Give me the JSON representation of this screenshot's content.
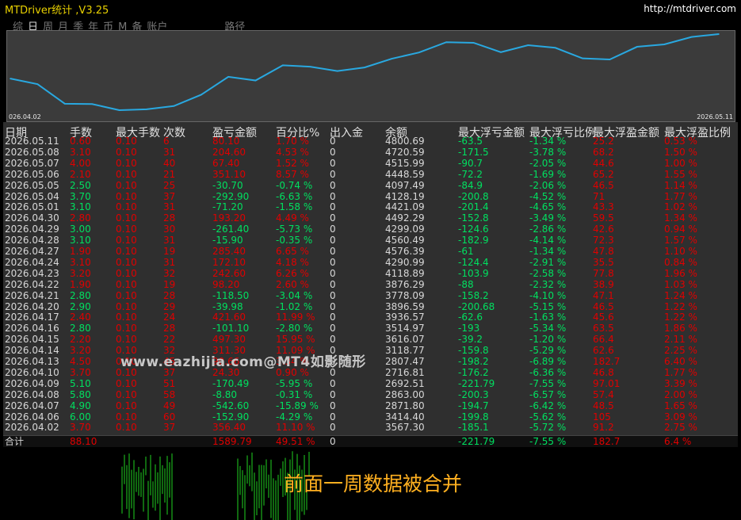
{
  "app": {
    "title": "MTDriver统计 ,V3.25",
    "url": "http://mtdriver.com"
  },
  "tabs": [
    {
      "label": "综",
      "active": false
    },
    {
      "label": "日",
      "active": true
    },
    {
      "label": "周",
      "active": false
    },
    {
      "label": "月",
      "active": false
    },
    {
      "label": "季",
      "active": false
    },
    {
      "label": "年",
      "active": false
    },
    {
      "label": "币",
      "active": false
    },
    {
      "label": "M",
      "active": false
    },
    {
      "label": "备",
      "active": false
    },
    {
      "label": "账户",
      "active": false
    }
  ],
  "path_label": "路径",
  "chart_data": {
    "type": "line",
    "x_start_label": "026.04.02",
    "x_end_label": "2026.05.11",
    "color": "#29a8e0",
    "x": [
      "2026.04.02",
      "2026.04.06",
      "2026.04.07",
      "2026.04.08",
      "2026.04.09",
      "2026.04.10",
      "2026.04.13",
      "2026.04.14",
      "2026.04.15",
      "2026.04.16",
      "2026.04.17",
      "2026.04.20",
      "2026.04.21",
      "2026.04.22",
      "2026.04.23",
      "2026.04.24",
      "2026.04.27",
      "2026.04.28",
      "2026.04.29",
      "2026.04.30",
      "2026.05.01",
      "2026.05.04",
      "2026.05.05",
      "2026.05.06",
      "2026.05.07",
      "2026.05.08",
      "2026.05.11"
    ],
    "values": [
      3567.3,
      3414.4,
      2871.8,
      2863.0,
      2692.51,
      2716.81,
      2807.47,
      3118.77,
      3616.07,
      3514.97,
      3936.57,
      3896.59,
      3778.09,
      3876.29,
      4118.89,
      4290.99,
      4576.39,
      4560.49,
      4299.09,
      4492.29,
      4421.09,
      4128.19,
      4097.49,
      4448.59,
      4515.99,
      4720.59,
      4800.69
    ]
  },
  "table": {
    "headers": [
      "日期",
      "手数",
      "最大手数",
      "次数",
      "盈亏金额",
      "百分比%",
      "出入金",
      "余额",
      "最大浮亏金额",
      "最大浮亏比例",
      "最大浮盈金额",
      "最大浮盈比例"
    ],
    "rows": [
      {
        "date": "2026.05.11",
        "lots": "0.60",
        "max_lots": "0.10",
        "count": "6",
        "pnl": "80.10",
        "pct": "1.70 %",
        "io": "0",
        "bal": "4800.69",
        "mfl": "-63.5",
        "mflp": "-1.34 %",
        "mfp": "25.2",
        "mfpp": "0.53 %",
        "s": "red"
      },
      {
        "date": "2026.05.08",
        "lots": "3.10",
        "max_lots": "0.10",
        "count": "31",
        "pnl": "204.60",
        "pct": "4.53 %",
        "io": "0",
        "bal": "4720.59",
        "mfl": "-171.5",
        "mflp": "-3.78 %",
        "mfp": "68.2",
        "mfpp": "1.50 %",
        "s": "red"
      },
      {
        "date": "2026.05.07",
        "lots": "4.00",
        "max_lots": "0.10",
        "count": "40",
        "pnl": "67.40",
        "pct": "1.52 %",
        "io": "0",
        "bal": "4515.99",
        "mfl": "-90.7",
        "mflp": "-2.05 %",
        "mfp": "44.6",
        "mfpp": "1.00 %",
        "s": "red"
      },
      {
        "date": "2026.05.06",
        "lots": "2.10",
        "max_lots": "0.10",
        "count": "21",
        "pnl": "351.10",
        "pct": "8.57 %",
        "io": "0",
        "bal": "4448.59",
        "mfl": "-72.2",
        "mflp": "-1.69 %",
        "mfp": "65.2",
        "mfpp": "1.55 %",
        "s": "red"
      },
      {
        "date": "2026.05.05",
        "lots": "2.50",
        "max_lots": "0.10",
        "count": "25",
        "pnl": "-30.70",
        "pct": "-0.74 %",
        "io": "0",
        "bal": "4097.49",
        "mfl": "-84.9",
        "mflp": "-2.06 %",
        "mfp": "46.5",
        "mfpp": "1.14 %",
        "s": "grn"
      },
      {
        "date": "2026.05.04",
        "lots": "3.70",
        "max_lots": "0.10",
        "count": "37",
        "pnl": "-292.90",
        "pct": "-6.63 %",
        "io": "0",
        "bal": "4128.19",
        "mfl": "-200.8",
        "mflp": "-4.52 %",
        "mfp": "71",
        "mfpp": "1.77 %",
        "s": "grn"
      },
      {
        "date": "2026.05.01",
        "lots": "3.10",
        "max_lots": "0.10",
        "count": "31",
        "pnl": "-71.20",
        "pct": "-1.58 %",
        "io": "0",
        "bal": "4421.09",
        "mfl": "-201.4",
        "mflp": "-4.65 %",
        "mfp": "43.3",
        "mfpp": "1.02 %",
        "s": "grn"
      },
      {
        "date": "2026.04.30",
        "lots": "2.80",
        "max_lots": "0.10",
        "count": "28",
        "pnl": "193.20",
        "pct": "4.49 %",
        "io": "0",
        "bal": "4492.29",
        "mfl": "-152.8",
        "mflp": "-3.49 %",
        "mfp": "59.5",
        "mfpp": "1.34 %",
        "s": "red"
      },
      {
        "date": "2026.04.29",
        "lots": "3.00",
        "max_lots": "0.10",
        "count": "30",
        "pnl": "-261.40",
        "pct": "-5.73 %",
        "io": "0",
        "bal": "4299.09",
        "mfl": "-124.6",
        "mflp": "-2.86 %",
        "mfp": "42.6",
        "mfpp": "0.94 %",
        "s": "grn"
      },
      {
        "date": "2026.04.28",
        "lots": "3.10",
        "max_lots": "0.10",
        "count": "31",
        "pnl": "-15.90",
        "pct": "-0.35 %",
        "io": "0",
        "bal": "4560.49",
        "mfl": "-182.9",
        "mflp": "-4.14 %",
        "mfp": "72.3",
        "mfpp": "1.57 %",
        "s": "grn"
      },
      {
        "date": "2026.04.27",
        "lots": "1.90",
        "max_lots": "0.10",
        "count": "19",
        "pnl": "285.40",
        "pct": "6.65 %",
        "io": "0",
        "bal": "4576.39",
        "mfl": "-61",
        "mflp": "-1.34 %",
        "mfp": "47.8",
        "mfpp": "1.10 %",
        "s": "red"
      },
      {
        "date": "2026.04.24",
        "lots": "3.10",
        "max_lots": "0.10",
        "count": "31",
        "pnl": "172.10",
        "pct": "4.18 %",
        "io": "0",
        "bal": "4290.99",
        "mfl": "-124.4",
        "mflp": "-2.91 %",
        "mfp": "35.5",
        "mfpp": "0.84 %",
        "s": "red"
      },
      {
        "date": "2026.04.23",
        "lots": "3.20",
        "max_lots": "0.10",
        "count": "32",
        "pnl": "242.60",
        "pct": "6.26 %",
        "io": "0",
        "bal": "4118.89",
        "mfl": "-103.9",
        "mflp": "-2.58 %",
        "mfp": "77.8",
        "mfpp": "1.96 %",
        "s": "red"
      },
      {
        "date": "2026.04.22",
        "lots": "1.90",
        "max_lots": "0.10",
        "count": "19",
        "pnl": "98.20",
        "pct": "2.60 %",
        "io": "0",
        "bal": "3876.29",
        "mfl": "-88",
        "mflp": "-2.32 %",
        "mfp": "38.9",
        "mfpp": "1.03 %",
        "s": "red"
      },
      {
        "date": "2026.04.21",
        "lots": "2.80",
        "max_lots": "0.10",
        "count": "28",
        "pnl": "-118.50",
        "pct": "-3.04 %",
        "io": "0",
        "bal": "3778.09",
        "mfl": "-158.2",
        "mflp": "-4.10 %",
        "mfp": "47.1",
        "mfpp": "1.24 %",
        "s": "grn"
      },
      {
        "date": "2026.04.20",
        "lots": "2.90",
        "max_lots": "0.10",
        "count": "29",
        "pnl": "-39.98",
        "pct": "-1.02 %",
        "io": "0",
        "bal": "3896.59",
        "mfl": "-200.68",
        "mflp": "-5.15 %",
        "mfp": "46.5",
        "mfpp": "1.22 %",
        "s": "grn"
      },
      {
        "date": "2026.04.17",
        "lots": "2.40",
        "max_lots": "0.10",
        "count": "24",
        "pnl": "421.60",
        "pct": "11.99 %",
        "io": "0",
        "bal": "3936.57",
        "mfl": "-62.6",
        "mflp": "-1.63 %",
        "mfp": "45.6",
        "mfpp": "1.22 %",
        "s": "red"
      },
      {
        "date": "2026.04.16",
        "lots": "2.80",
        "max_lots": "0.10",
        "count": "28",
        "pnl": "-101.10",
        "pct": "-2.80 %",
        "io": "0",
        "bal": "3514.97",
        "mfl": "-193",
        "mflp": "-5.34 %",
        "mfp": "63.5",
        "mfpp": "1.86 %",
        "s": "grn"
      },
      {
        "date": "2026.04.15",
        "lots": "2.20",
        "max_lots": "0.10",
        "count": "22",
        "pnl": "497.30",
        "pct": "15.95 %",
        "io": "0",
        "bal": "3616.07",
        "mfl": "-39.2",
        "mflp": "-1.20 %",
        "mfp": "66.4",
        "mfpp": "2.11 %",
        "s": "red"
      },
      {
        "date": "2026.04.14",
        "lots": "3.20",
        "max_lots": "0.10",
        "count": "32",
        "pnl": "311.30",
        "pct": "11.09 %",
        "io": "0",
        "bal": "3118.77",
        "mfl": "-159.8",
        "mflp": "-5.29 %",
        "mfp": "62.6",
        "mfpp": "2.25 %",
        "s": "red"
      },
      {
        "date": "2026.04.13",
        "lots": "4.50",
        "max_lots": "0.10",
        "count": "45",
        "pnl": "90.66",
        "pct": "3.34 %",
        "io": "0",
        "bal": "2807.47",
        "mfl": "-198.2",
        "mflp": "-6.89 %",
        "mfp": "182.7",
        "mfpp": "6.40 %",
        "s": "red"
      },
      {
        "date": "2026.04.10",
        "lots": "3.70",
        "max_lots": "0.10",
        "count": "37",
        "pnl": "24.30",
        "pct": "0.90 %",
        "io": "0",
        "bal": "2716.81",
        "mfl": "-176.2",
        "mflp": "-6.36 %",
        "mfp": "46.8",
        "mfpp": "1.77 %",
        "s": "red"
      },
      {
        "date": "2026.04.09",
        "lots": "5.10",
        "max_lots": "0.10",
        "count": "51",
        "pnl": "-170.49",
        "pct": "-5.95 %",
        "io": "0",
        "bal": "2692.51",
        "mfl": "-221.79",
        "mflp": "-7.55 %",
        "mfp": "97.01",
        "mfpp": "3.39 %",
        "s": "grn"
      },
      {
        "date": "2026.04.08",
        "lots": "5.80",
        "max_lots": "0.10",
        "count": "58",
        "pnl": "-8.80",
        "pct": "-0.31 %",
        "io": "0",
        "bal": "2863.00",
        "mfl": "-200.3",
        "mflp": "-6.57 %",
        "mfp": "57.4",
        "mfpp": "2.00 %",
        "s": "grn"
      },
      {
        "date": "2026.04.07",
        "lots": "4.90",
        "max_lots": "0.10",
        "count": "49",
        "pnl": "-542.60",
        "pct": "-15.89 %",
        "io": "0",
        "bal": "2871.80",
        "mfl": "-194.7",
        "mflp": "-6.42 %",
        "mfp": "48.5",
        "mfpp": "1.65 %",
        "s": "grn"
      },
      {
        "date": "2026.04.06",
        "lots": "6.00",
        "max_lots": "0.10",
        "count": "60",
        "pnl": "-152.90",
        "pct": "-4.29 %",
        "io": "0",
        "bal": "3414.40",
        "mfl": "-199.8",
        "mflp": "-5.62 %",
        "mfp": "105",
        "mfpp": "3.09 %",
        "s": "grn"
      },
      {
        "date": "2026.04.02",
        "lots": "3.70",
        "max_lots": "0.10",
        "count": "37",
        "pnl": "356.40",
        "pct": "11.10 %",
        "io": "0",
        "bal": "3567.30",
        "mfl": "-185.1",
        "mflp": "-5.72 %",
        "mfp": "91.2",
        "mfpp": "2.75 %",
        "s": "red"
      }
    ],
    "total": {
      "label": "合计",
      "lots": "88.10",
      "pnl": "1589.79",
      "pct": "49.51 %",
      "io": "0",
      "mfl": "-221.79",
      "mflp": "-7.55 %",
      "mfp": "182.7",
      "mfpp": "6.4 %"
    }
  },
  "watermark": "www.eazhijia.com@MT4如影随形",
  "caption": "前面一周数据被合并",
  "colors": {
    "profit": "#e00000",
    "loss": "#00e060",
    "line": "#29a8e0",
    "title": "#e8d000",
    "caption": "#ffb020"
  }
}
